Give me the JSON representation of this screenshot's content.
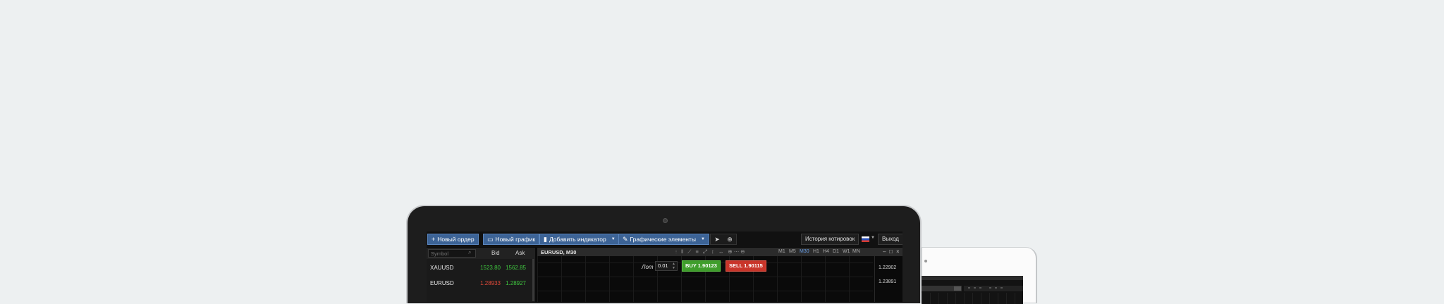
{
  "toolbar": {
    "new_order": "Новый ордер",
    "new_chart": "Новый график",
    "add_indicator": "Добавить индикатор",
    "graphic_elements": "Графические элементы",
    "quote_history": "История котировок",
    "exit": "Выход"
  },
  "watchlist": {
    "search_placeholder": "Symbol",
    "col_bid": "Bid",
    "col_ask": "Ask",
    "rows": [
      {
        "symbol": "XAUUSD",
        "bid": "1523.80",
        "ask": "1562.85"
      },
      {
        "symbol": "EURUSD",
        "bid": "1.28933",
        "ask": "1.28927"
      }
    ]
  },
  "chart": {
    "title": "EURUSD, M30",
    "timeframes": [
      "M1",
      "M5",
      "M30",
      "H1",
      "H4",
      "D1",
      "W1",
      "MN"
    ],
    "active_timeframe": "M30",
    "lot_label": "Лот",
    "lot_value": "0.01",
    "buy_label": "BUY 1.90123",
    "sell_label": "SELL 1.90115",
    "price_labels": [
      "1.22902",
      "1.23891"
    ]
  },
  "colors": {
    "page_bg": "#edf0f1",
    "toolbar_button": "#3c6396",
    "buy": "#3f9e2c",
    "sell": "#c9352a",
    "price_up": "#3fc63f",
    "price_down": "#e04a3a",
    "timeframe_active": "#6aa0ea"
  }
}
